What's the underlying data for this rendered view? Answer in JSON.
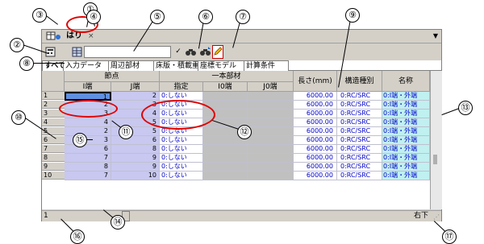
{
  "window": {
    "tab_title": "はり",
    "tab_close": "×",
    "menu_arrow": "▼"
  },
  "toolbar": {
    "wrench_icon": "🔧",
    "calc_icon": "▦",
    "grid_icon": "▦",
    "check_glyph": "✓",
    "find_icon_1": "⚲",
    "find_icon_2": "⚲",
    "pencil_icon": "✎",
    "field_value": ""
  },
  "tabs": [
    "すべて",
    "入力データ",
    "周辺部材",
    "床版・積載重",
    "座標モデル",
    "計算条件"
  ],
  "headers": {
    "node": "節点",
    "node_i": "I端",
    "node_j": "J端",
    "member": "一本部材",
    "spec": "指定",
    "i0": "I0端",
    "j0": "J0端",
    "length": "長さ(mm)",
    "struct_type": "構造種別",
    "name": "名称"
  },
  "rows": [
    {
      "no": "1",
      "i": "1",
      "j": "2",
      "spec": "0:しない",
      "length": "6000.00",
      "type": "0:RC/SRC",
      "name": "0:I端・外端"
    },
    {
      "no": "2",
      "i": "2",
      "j": "3",
      "spec": "0:しない",
      "length": "6000.00",
      "type": "0:RC/SRC",
      "name": "0:I端・外端"
    },
    {
      "no": "3",
      "i": "3",
      "j": "4",
      "spec": "0:しない",
      "length": "6000.00",
      "type": "0:RC/SRC",
      "name": "0:I端・外端"
    },
    {
      "no": "4",
      "i": "4",
      "j": "5",
      "spec": "0:しない",
      "length": "6000.00",
      "type": "0:RC/SRC",
      "name": "0:I端・外端"
    },
    {
      "no": "5",
      "i": "2",
      "j": "5",
      "spec": "0:しない",
      "length": "6000.00",
      "type": "0:RC/SRC",
      "name": "0:I端・外端"
    },
    {
      "no": "6",
      "i": "3",
      "j": "6",
      "spec": "0:しない",
      "length": "6000.00",
      "type": "0:RC/SRC",
      "name": "0:I端・外端"
    },
    {
      "no": "7",
      "i": "6",
      "j": "8",
      "spec": "0:しない",
      "length": "6000.00",
      "type": "0:RC/SRC",
      "name": "0:I端・外端"
    },
    {
      "no": "8",
      "i": "7",
      "j": "9",
      "spec": "0:しない",
      "length": "6000.00",
      "type": "0:RC/SRC",
      "name": "0:I端・外端"
    },
    {
      "no": "9",
      "i": "8",
      "j": "9",
      "spec": "0:しない",
      "length": "6000.00",
      "type": "0:RC/SRC",
      "name": "0:I端・外端"
    },
    {
      "no": "10",
      "i": "7",
      "j": "10",
      "spec": "0:しない",
      "length": "6000.00",
      "type": "0:RC/SRC",
      "name": "0:I端・外端"
    }
  ],
  "status": {
    "left": "1",
    "right": "右下"
  },
  "callouts": [
    "①",
    "②",
    "③",
    "④",
    "⑤",
    "⑥",
    "⑦",
    "⑧",
    "⑨",
    "⑩",
    "⑪",
    "⑫",
    "⑬",
    "⑭",
    "⑮",
    "⑯",
    "⑰"
  ],
  "colors": {
    "highlight": "#e00000",
    "node_fill": "#c8c8f0",
    "name_fill": "#c0f0f0",
    "value_text": "#0000cc"
  }
}
